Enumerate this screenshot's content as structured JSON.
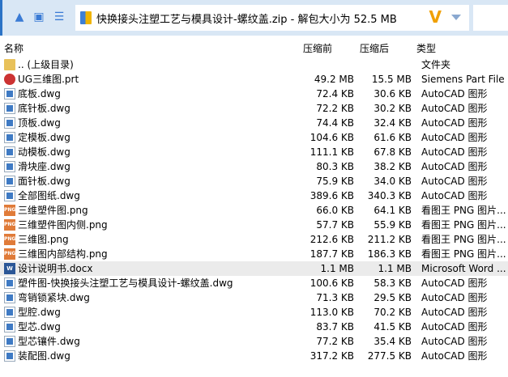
{
  "toolbar": {
    "path": "快换接头注塑工艺与模具设计-螺纹盖.zip - 解包大小为 52.5 MB"
  },
  "columns": {
    "name": "名称",
    "size": "压缩前",
    "packed": "压缩后",
    "type": "类型"
  },
  "files": [
    {
      "name": ".. (上级目录)",
      "size": "",
      "packed": "",
      "type": "文件夹",
      "icon": "folder"
    },
    {
      "name": "UG三维图.prt",
      "size": "49.2 MB",
      "packed": "15.5 MB",
      "type": "Siemens Part File",
      "icon": "prt"
    },
    {
      "name": "底板.dwg",
      "size": "72.4 KB",
      "packed": "30.6 KB",
      "type": "AutoCAD 图形",
      "icon": "dwg"
    },
    {
      "name": "底针板.dwg",
      "size": "72.2 KB",
      "packed": "30.2 KB",
      "type": "AutoCAD 图形",
      "icon": "dwg"
    },
    {
      "name": "顶板.dwg",
      "size": "74.4 KB",
      "packed": "32.4 KB",
      "type": "AutoCAD 图形",
      "icon": "dwg"
    },
    {
      "name": "定模板.dwg",
      "size": "104.6 KB",
      "packed": "61.6 KB",
      "type": "AutoCAD 图形",
      "icon": "dwg"
    },
    {
      "name": "动模板.dwg",
      "size": "111.1 KB",
      "packed": "67.8 KB",
      "type": "AutoCAD 图形",
      "icon": "dwg"
    },
    {
      "name": "滑块座.dwg",
      "size": "80.3 KB",
      "packed": "38.2 KB",
      "type": "AutoCAD 图形",
      "icon": "dwg"
    },
    {
      "name": "面针板.dwg",
      "size": "75.9 KB",
      "packed": "34.0 KB",
      "type": "AutoCAD 图形",
      "icon": "dwg"
    },
    {
      "name": "全部图纸.dwg",
      "size": "389.6 KB",
      "packed": "340.3 KB",
      "type": "AutoCAD 图形",
      "icon": "dwg"
    },
    {
      "name": "三维塑件图.png",
      "size": "66.0 KB",
      "packed": "64.1 KB",
      "type": "看图王 PNG 图片...",
      "icon": "png"
    },
    {
      "name": "三维塑件图内侧.png",
      "size": "57.7 KB",
      "packed": "55.9 KB",
      "type": "看图王 PNG 图片...",
      "icon": "png"
    },
    {
      "name": "三维图.png",
      "size": "212.6 KB",
      "packed": "211.2 KB",
      "type": "看图王 PNG 图片...",
      "icon": "png"
    },
    {
      "name": "三维图内部结构.png",
      "size": "187.7 KB",
      "packed": "186.3 KB",
      "type": "看图王 PNG 图片...",
      "icon": "png"
    },
    {
      "name": "设计说明书.docx",
      "size": "1.1 MB",
      "packed": "1.1 MB",
      "type": "Microsoft Word ...",
      "icon": "doc"
    },
    {
      "name": "塑件图-快换接头注塑工艺与模具设计-螺纹盖.dwg",
      "size": "100.6 KB",
      "packed": "58.3 KB",
      "type": "AutoCAD 图形",
      "icon": "dwg"
    },
    {
      "name": "弯销锁紧块.dwg",
      "size": "71.3 KB",
      "packed": "29.5 KB",
      "type": "AutoCAD 图形",
      "icon": "dwg"
    },
    {
      "name": "型腔.dwg",
      "size": "113.0 KB",
      "packed": "70.2 KB",
      "type": "AutoCAD 图形",
      "icon": "dwg"
    },
    {
      "name": "型芯.dwg",
      "size": "83.7 KB",
      "packed": "41.5 KB",
      "type": "AutoCAD 图形",
      "icon": "dwg"
    },
    {
      "name": "型芯镶件.dwg",
      "size": "77.2 KB",
      "packed": "35.4 KB",
      "type": "AutoCAD 图形",
      "icon": "dwg"
    },
    {
      "name": "装配图.dwg",
      "size": "317.2 KB",
      "packed": "277.5 KB",
      "type": "AutoCAD 图形",
      "icon": "dwg"
    }
  ]
}
